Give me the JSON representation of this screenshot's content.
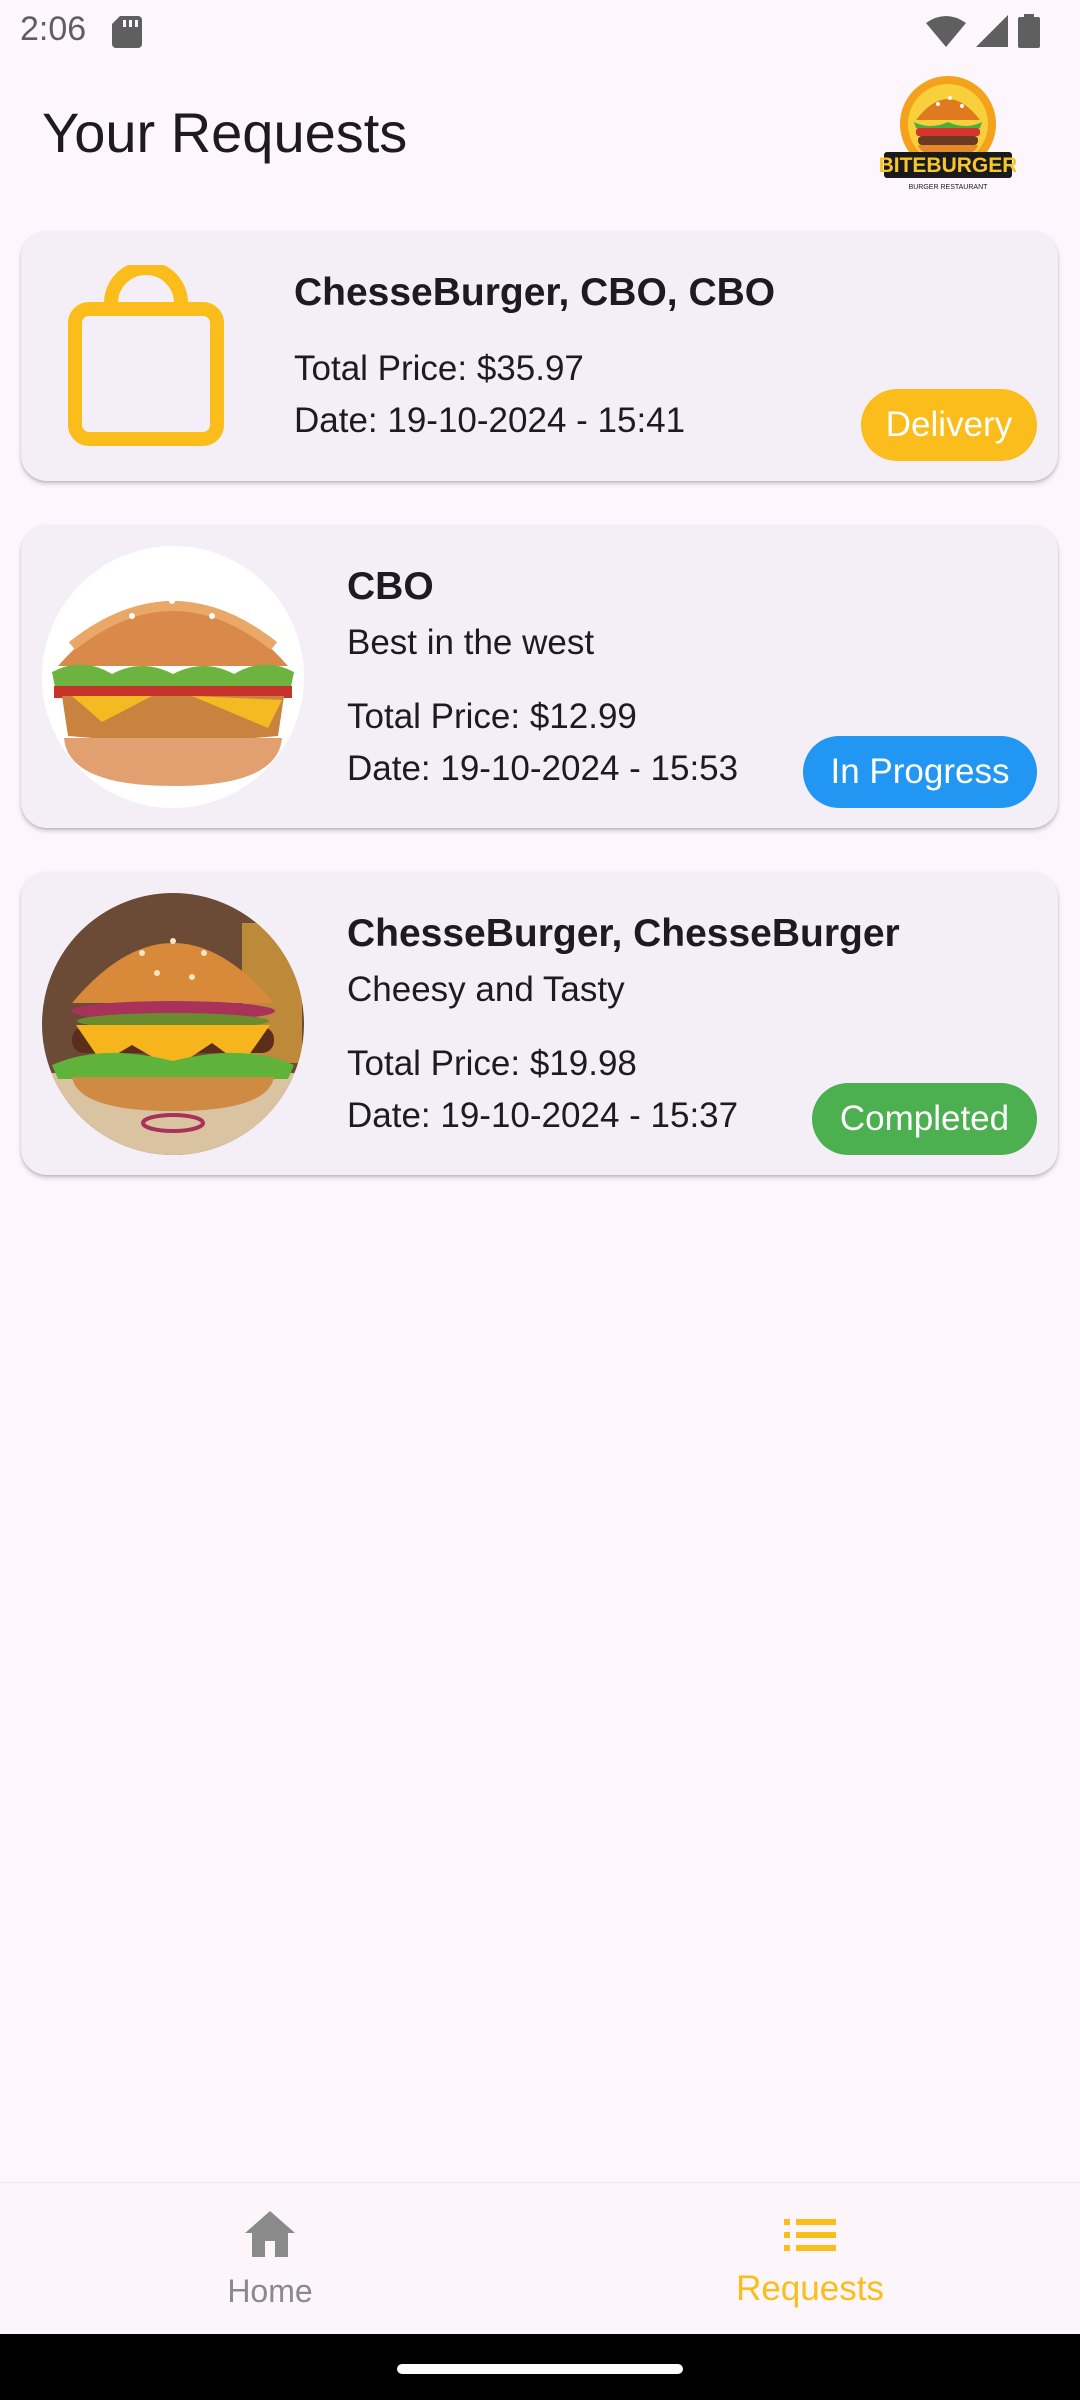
{
  "status_bar": {
    "time": "2:06"
  },
  "header": {
    "title": "Your Requests",
    "logo_text": "BITEBURGER",
    "logo_tagline": "BURGER RESTAURANT"
  },
  "requests": [
    {
      "title": "ChesseBurger, CBO, CBO",
      "total": "Total Price: $35.97",
      "date": "Date: 19-10-2024 - 15:41",
      "status": "Delivery",
      "status_color": "#fbbd1c",
      "icon": "shopping-bag-icon"
    },
    {
      "title": "CBO",
      "subtitle": "Best in the west",
      "total": "Total Price: $12.99",
      "date": "Date: 19-10-2024 - 15:53",
      "status": "In Progress",
      "status_color": "#2196f3",
      "icon": "chicken-burger-image"
    },
    {
      "title": "ChesseBurger, ChesseBurger",
      "subtitle": "Cheesy and Tasty",
      "total": "Total Price: $19.98",
      "date": "Date: 19-10-2024 - 15:37",
      "status": "Completed",
      "status_color": "#4caf50",
      "icon": "cheeseburger-image"
    }
  ],
  "bottom_nav": {
    "items": [
      {
        "label": "Home",
        "icon": "home-icon",
        "active": false
      },
      {
        "label": "Requests",
        "icon": "list-icon",
        "active": true
      }
    ],
    "active_color": "#fbbd1c",
    "inactive_color": "#8a8a8a"
  }
}
